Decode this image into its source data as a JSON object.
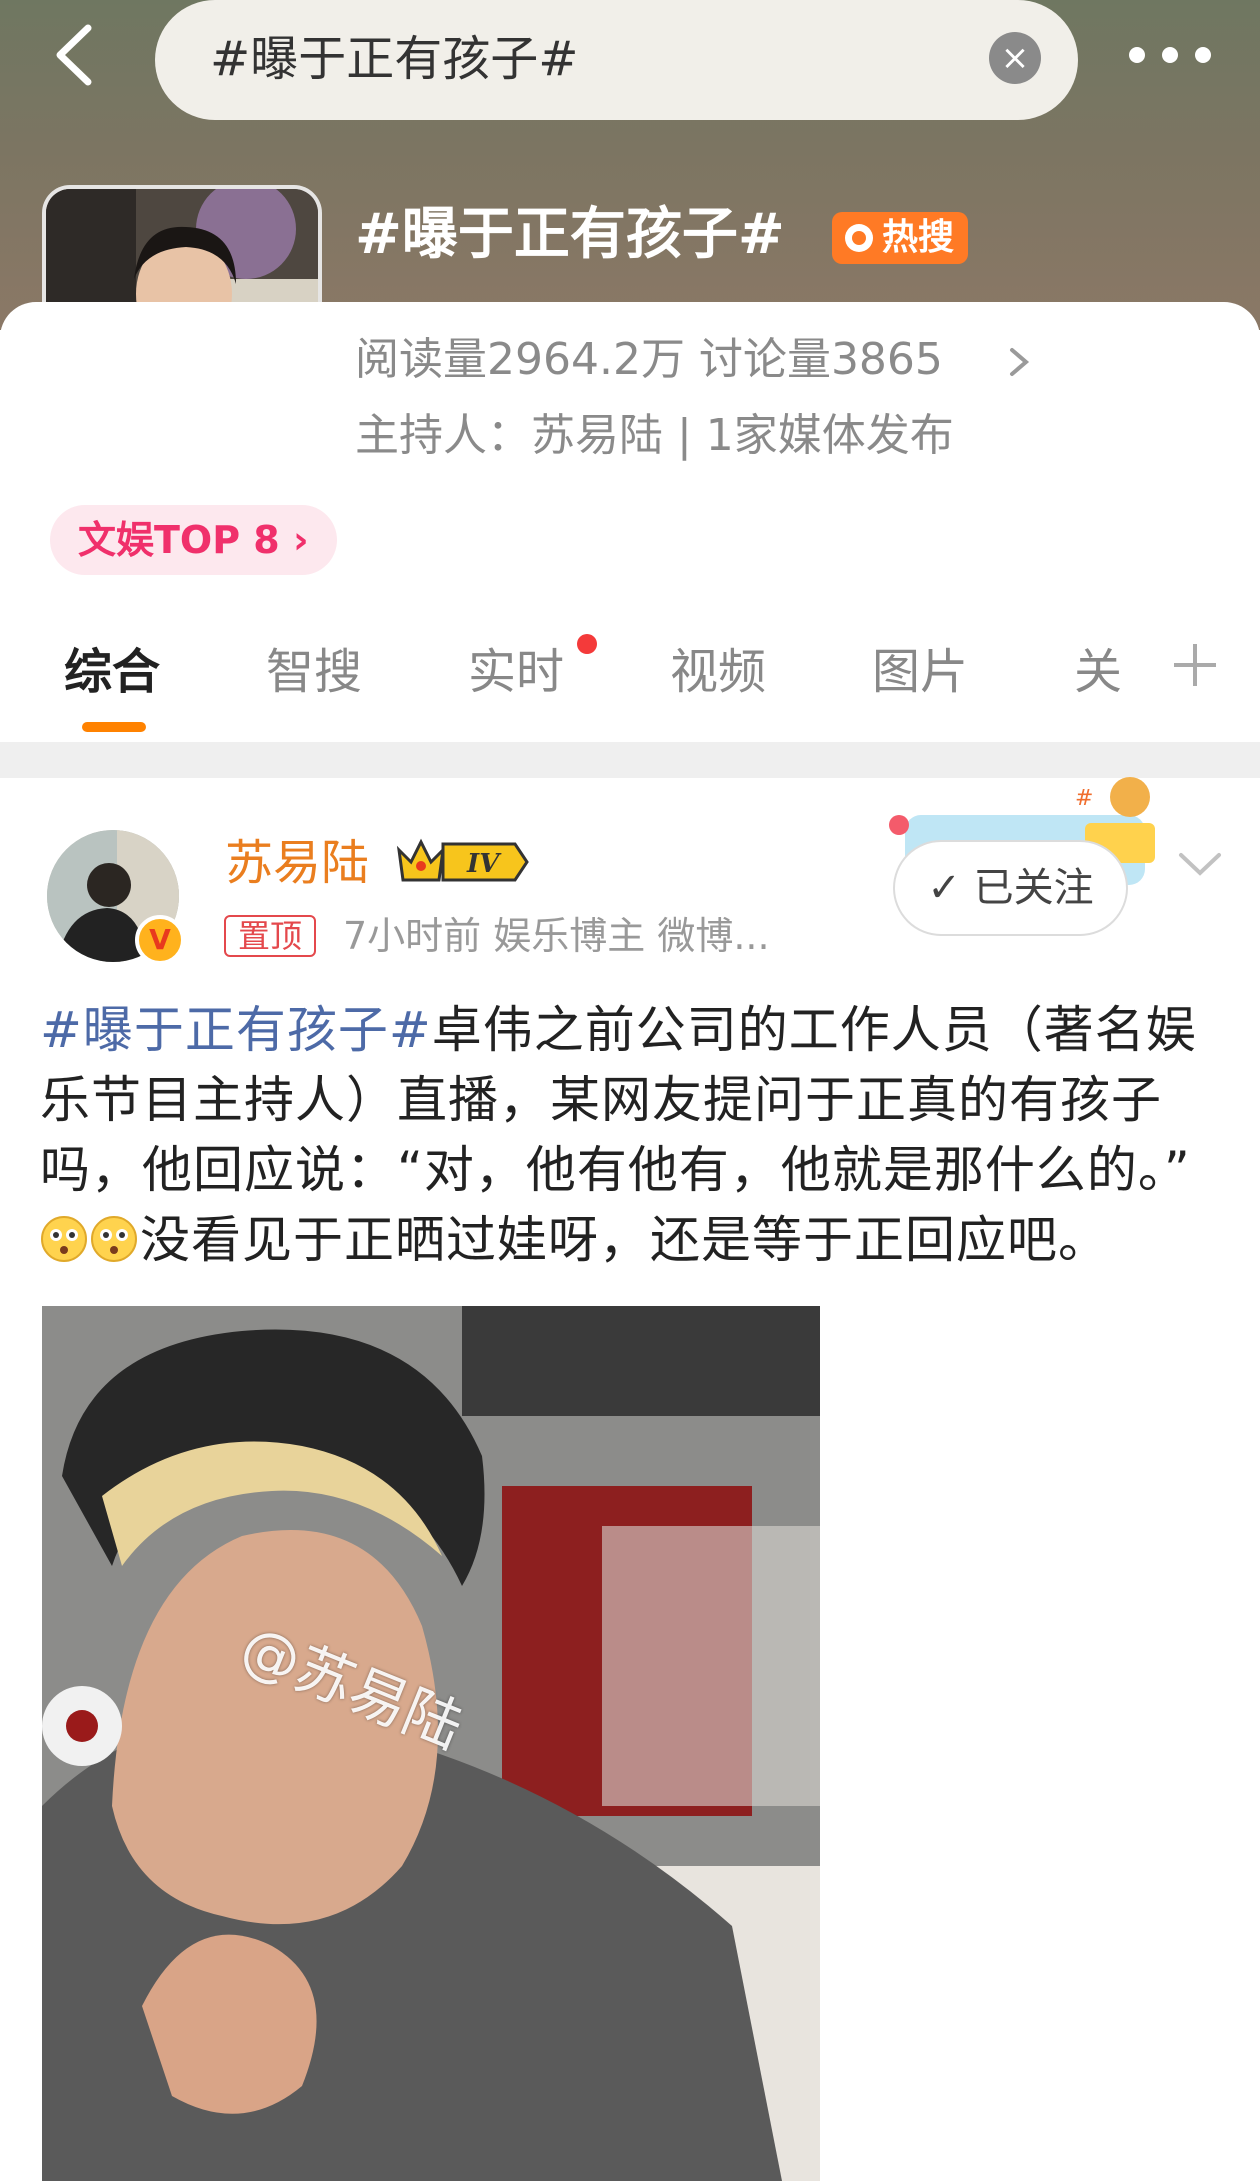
{
  "search": {
    "query": "#曝于正有孩子#",
    "clear_icon": "close-icon"
  },
  "topic": {
    "title": "#曝于正有孩子#",
    "badge": "热搜",
    "stats": "阅读量2964.2万   讨论量3865",
    "host": "主持人：苏易陆 | 1家媒体发布",
    "rank": "文娱TOP 8"
  },
  "tabs": [
    {
      "label": "综合"
    },
    {
      "label": "智搜"
    },
    {
      "label": "实时"
    },
    {
      "label": "视频"
    },
    {
      "label": "图片"
    },
    {
      "label": "关"
    }
  ],
  "post": {
    "author": "苏易陆",
    "level": "IV",
    "pinned": "置顶",
    "meta": "7小时前   娱乐博主 微博...",
    "follow_label": "已关注",
    "verify_mark": "V",
    "hashtag": "#曝于正有孩子#",
    "text1": "卓伟之前公司的工作人员（著名娱乐节目主持人）直播，某网友提问于正真的有孩子吗，他回应说：“对，他有他有，他就是那什么的。”",
    "text2": "没看见于正晒过娃呀，还是等于正回应吧。",
    "image_watermark": "@苏易陆"
  },
  "colors": {
    "accent": "#ff8200",
    "hashtag": "#4d6aa7",
    "author": "#ea7e1f",
    "hot_badge": "#ff7a25",
    "rank_text": "#f0306b"
  }
}
